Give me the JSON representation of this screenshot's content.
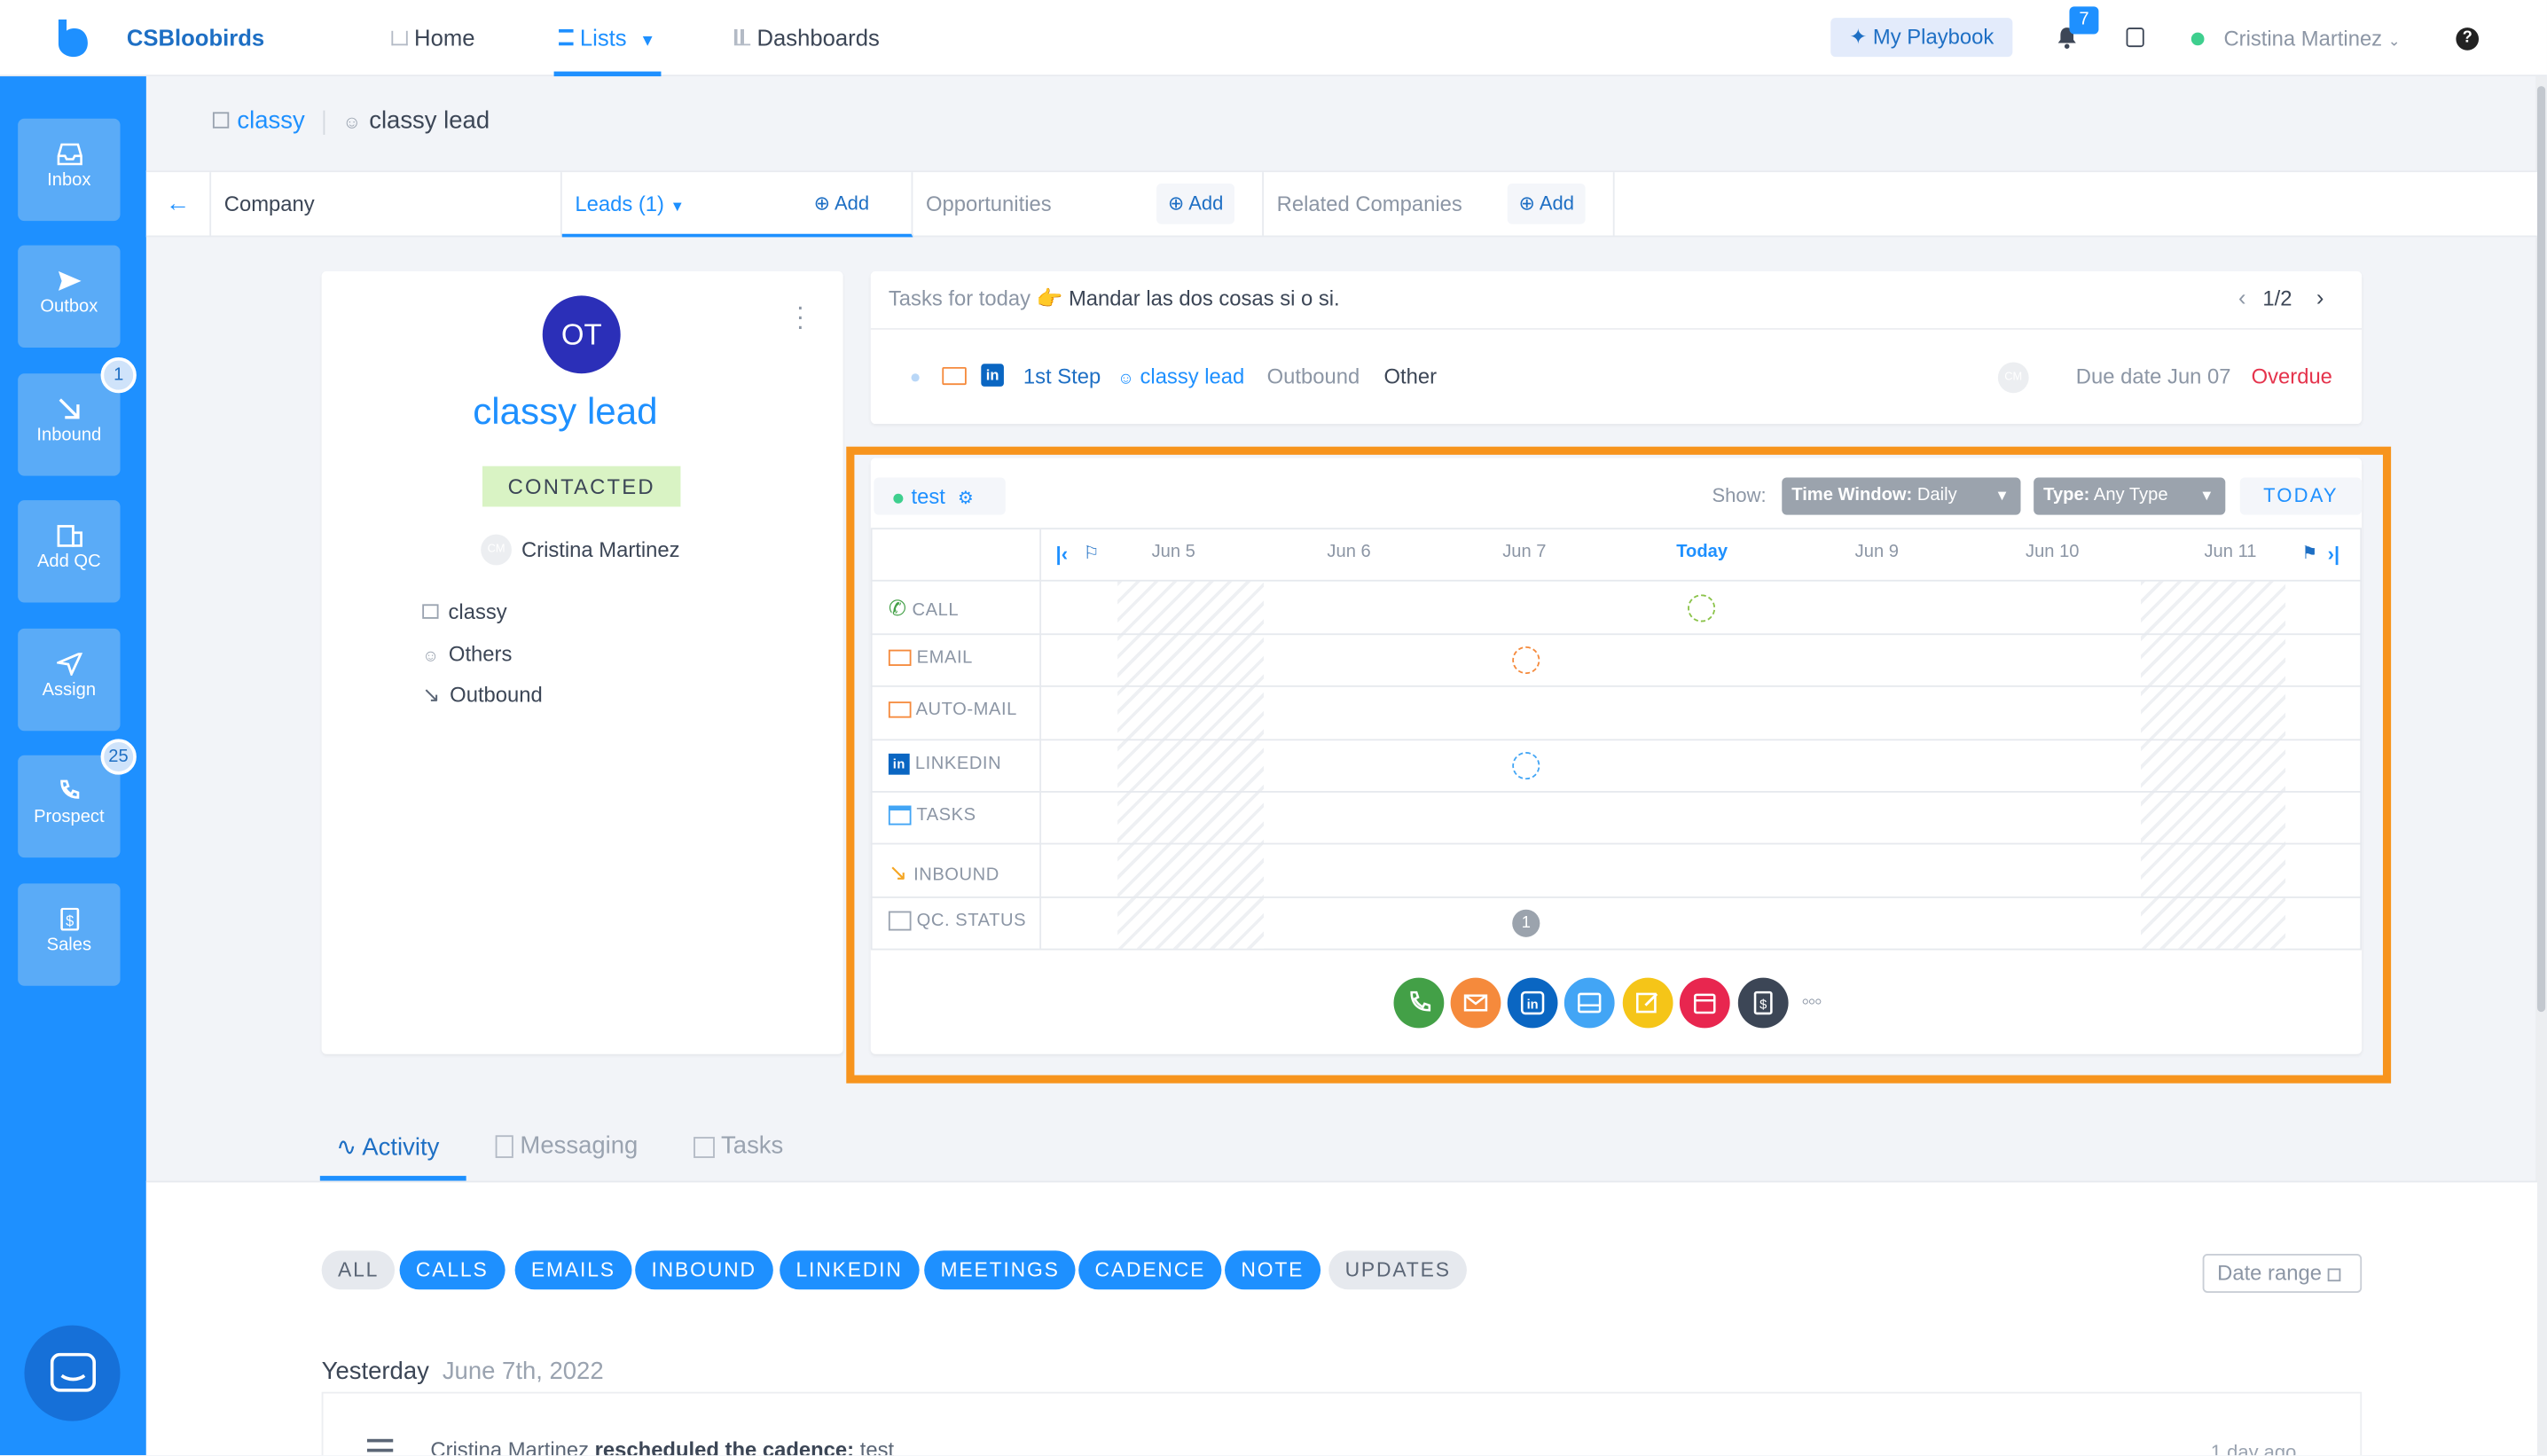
{
  "app": {
    "name": "CSBloobirds"
  },
  "nav": {
    "home": "Home",
    "lists": "Lists",
    "dashboards": "Dashboards",
    "playbook": "My Playbook",
    "notif_count": "7",
    "user": "Cristina Martinez",
    "help": "?"
  },
  "sidebar": [
    {
      "label": "Inbox",
      "badge": ""
    },
    {
      "label": "Outbox",
      "badge": ""
    },
    {
      "label": "Inbound",
      "badge": "1"
    },
    {
      "label": "Add QC",
      "badge": ""
    },
    {
      "label": "Assign",
      "badge": ""
    },
    {
      "label": "Prospect",
      "badge": "25"
    },
    {
      "label": "Sales",
      "badge": ""
    }
  ],
  "breadcrumb": {
    "company": "classy",
    "lead": "classy lead"
  },
  "tabs": {
    "company": "Company",
    "leads": "Leads (1)",
    "add": "Add",
    "opportunities": "Opportunities",
    "related": "Related Companies"
  },
  "lead": {
    "initials": "OT",
    "name": "classy lead",
    "status": "CONTACTED",
    "owner_initials": "CM",
    "owner": "Cristina Martinez",
    "company": "classy",
    "source": "Others",
    "type": "Outbound"
  },
  "tasks": {
    "prefix": "Tasks for today",
    "emoji": "👉",
    "text": "Mandar las dos cosas si o si.",
    "pager": "1/2",
    "step": "1st Step",
    "lead": "classy lead",
    "type": "Outbound",
    "category": "Other",
    "avatar": "CM",
    "due": "Due date Jun 07",
    "overdue": "Overdue"
  },
  "timeline": {
    "cadence": "test",
    "show": "Show:",
    "window_label": "Time Window:",
    "window_value": "Daily",
    "type_label": "Type:",
    "type_value": "Any Type",
    "today_btn": "TODAY",
    "days": [
      "Jun 5",
      "Jun 6",
      "Jun 7",
      "Today",
      "Jun 9",
      "Jun 10",
      "Jun 11"
    ],
    "rows": [
      "CALL",
      "EMAIL",
      "AUTO-MAIL",
      "LINKEDIN",
      "TASKS",
      "INBOUND",
      "QC. STATUS"
    ],
    "qc_count": "1",
    "colors": {
      "call": "#43a047",
      "email": "#f58a3c",
      "linkedin": "#0a66c2",
      "tasks": "#42a5f5",
      "inbound": "#f5a623",
      "highlight": "#f7941d"
    }
  },
  "activity": {
    "tabs": [
      "Activity",
      "Messaging",
      "Tasks"
    ],
    "filters": [
      "ALL",
      "CALLS",
      "EMAILS",
      "INBOUND",
      "LINKEDIN",
      "MEETINGS",
      "CADENCE",
      "NOTE",
      "UPDATES"
    ],
    "date_range": "Date range",
    "day": "Yesterday",
    "date": "June 7th, 2022",
    "entry_user": "Cristina Martinez",
    "entry_action": "rescheduled the cadence:",
    "entry_target": "test",
    "entry_time": "1 day ago"
  }
}
